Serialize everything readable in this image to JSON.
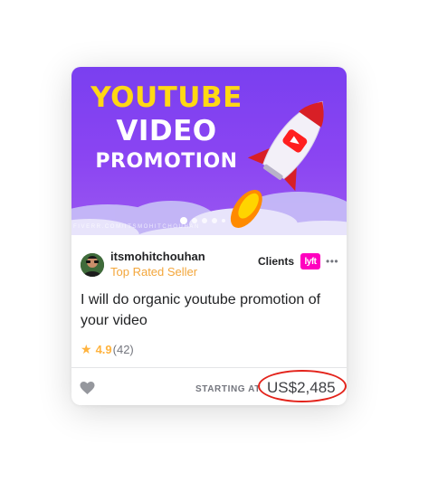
{
  "gig": {
    "banner": {
      "line1": "YOUTUBE",
      "line2": "VIDEO",
      "line3": "PROMOTION",
      "watermark": "FIVERR.COM/ITSMOHITCHOUHAN"
    },
    "slide_count": 5,
    "active_slide": 1,
    "seller": {
      "name": "itsmohitchouhan",
      "level": "Top Rated Seller"
    },
    "clients": {
      "label": "Clients",
      "logo_text": "lyft",
      "more_text": "•••"
    },
    "title": "I will do organic youtube promotion of your video",
    "rating": {
      "score": "4.9",
      "count": "(42)"
    },
    "footer": {
      "starting_label": "STARTING AT",
      "price": "US$2,485"
    }
  },
  "colors": {
    "banner_purple": "#7a3ff0",
    "headline_yellow": "#ffd814",
    "seller_level": "#f3a63b",
    "star": "#ffb33e",
    "lyft_pink": "#ff00bf",
    "highlight_circle": "#e3231b"
  },
  "icons": {
    "rating": "star-icon",
    "favorite": "heart-icon",
    "more": "more-icon"
  }
}
